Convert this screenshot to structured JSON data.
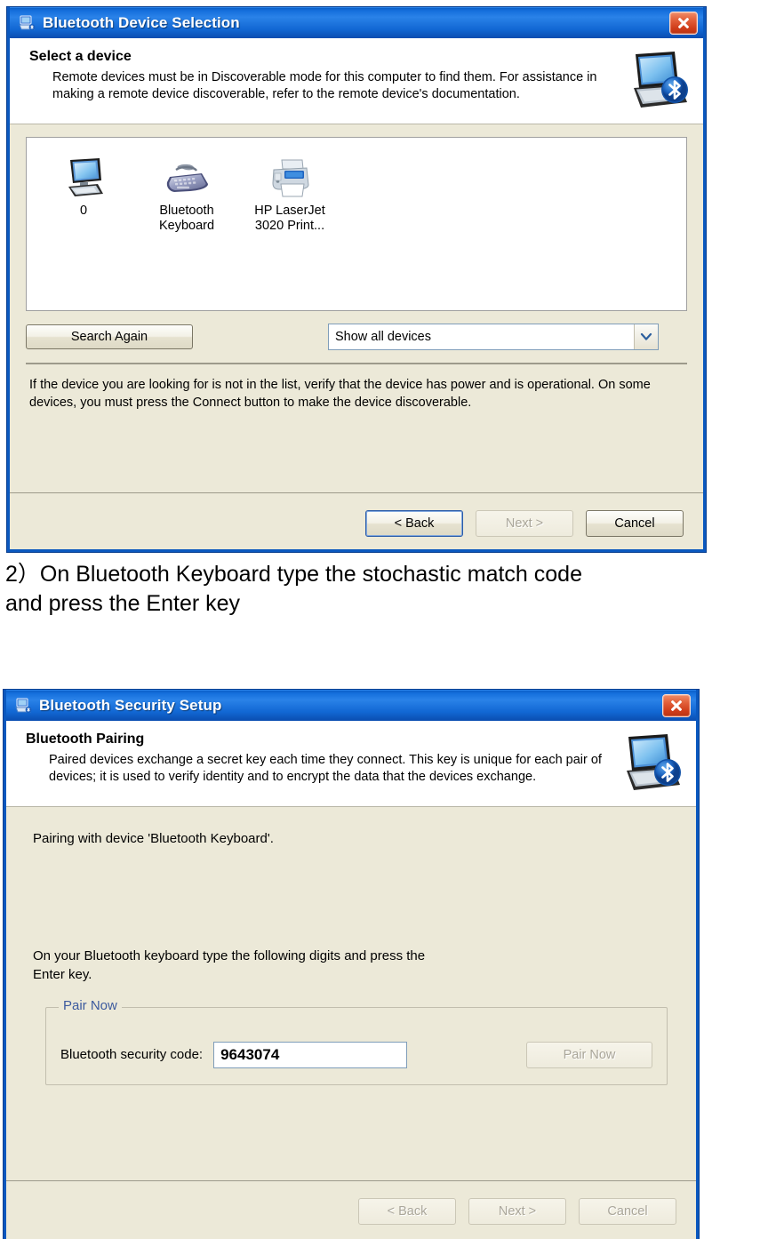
{
  "dialog1": {
    "title": "Bluetooth Device Selection",
    "title_icon": "bluetooth-computer-icon",
    "close_label": "Close",
    "header": {
      "heading": "Select a device",
      "description": "Remote devices must be in Discoverable mode for this computer to find them. For assistance in making a remote device discoverable, refer to the remote device's documentation.",
      "graphic": "laptop-bluetooth-icon"
    },
    "devices": [
      {
        "label": "0",
        "icon": "desktop-computer-icon"
      },
      {
        "label": "Bluetooth\nKeyboard",
        "icon": "keyboard-icon"
      },
      {
        "label": "HP LaserJet\n3020 Print...",
        "icon": "printer-icon"
      }
    ],
    "search_again_label": "Search Again",
    "filter": {
      "value": "Show all devices",
      "options": [
        "Show all devices"
      ]
    },
    "help_text": "If the device you are looking for is not in the list, verify that the device has power and is operational. On some devices, you must press the Connect button to make the device discoverable.",
    "buttons": {
      "back": "< Back",
      "next": "Next >",
      "cancel": "Cancel"
    }
  },
  "caption": {
    "line1": "2）On Bluetooth Keyboard type the stochastic match code",
    "line2": "and press the Enter key"
  },
  "dialog2": {
    "title": "Bluetooth Security Setup",
    "title_icon": "bluetooth-computer-icon",
    "close_label": "Close",
    "header": {
      "heading": "Bluetooth Pairing",
      "description": "Paired devices exchange a secret key each time they connect. This key is unique for each pair of devices; it is used to verify identity and to encrypt the data that the devices exchange.",
      "graphic": "laptop-bluetooth-icon"
    },
    "pairing_line": "Pairing with device 'Bluetooth Keyboard'.",
    "instruction_line1": "On your Bluetooth keyboard type the following digits and press the",
    "instruction_line2": "Enter key.",
    "group": {
      "title": "Pair Now",
      "code_label": "Bluetooth security code:",
      "code_value": "9643074",
      "code_placeholder": "",
      "pair_now_label": "Pair Now"
    },
    "buttons": {
      "back": "< Back",
      "next": "Next >",
      "cancel": "Cancel"
    }
  },
  "colors": {
    "titlebar_blue": "#1670dd",
    "window_border": "#0a58bf",
    "dialog_face": "#ece9d8",
    "close_red": "#cf3c19",
    "group_label_blue": "#3c5a9e",
    "bluetooth_blue": "#1a5fbe"
  }
}
